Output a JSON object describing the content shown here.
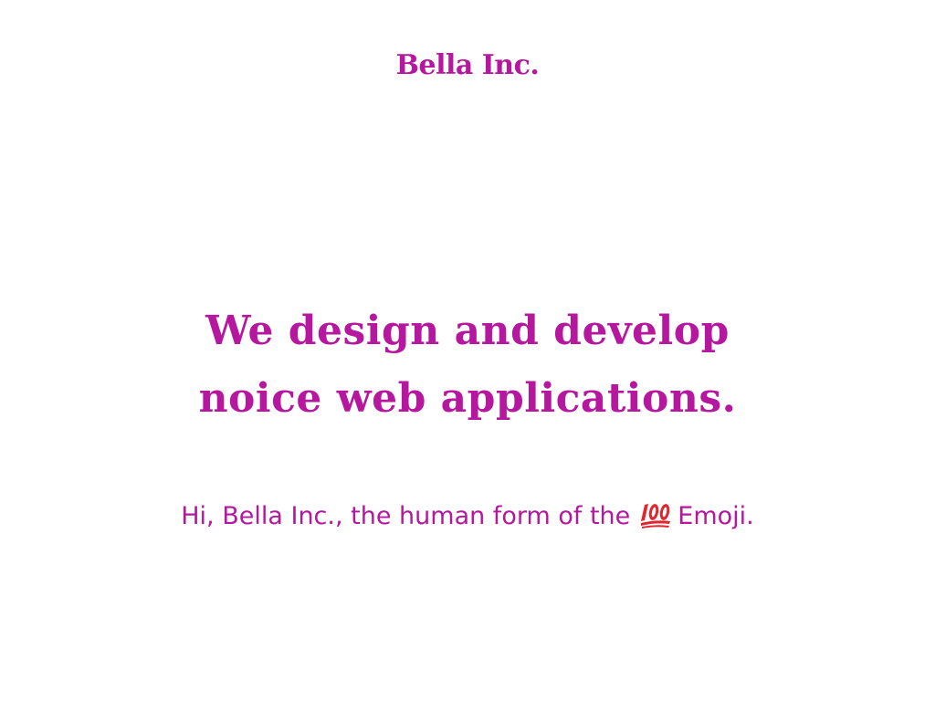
{
  "header": {
    "brand": "Bella Inc."
  },
  "hero": {
    "headline_line1": "We design and develop",
    "headline_line2": "noice web applications.",
    "intro_before": "Hi, Bella Inc., the human form of the",
    "emoji_icon": "hundred-points-icon",
    "intro_after": "Emoji."
  },
  "colors": {
    "accent": "#b5179e",
    "emoji_red": "#e0262e",
    "background": "#ffffff"
  }
}
